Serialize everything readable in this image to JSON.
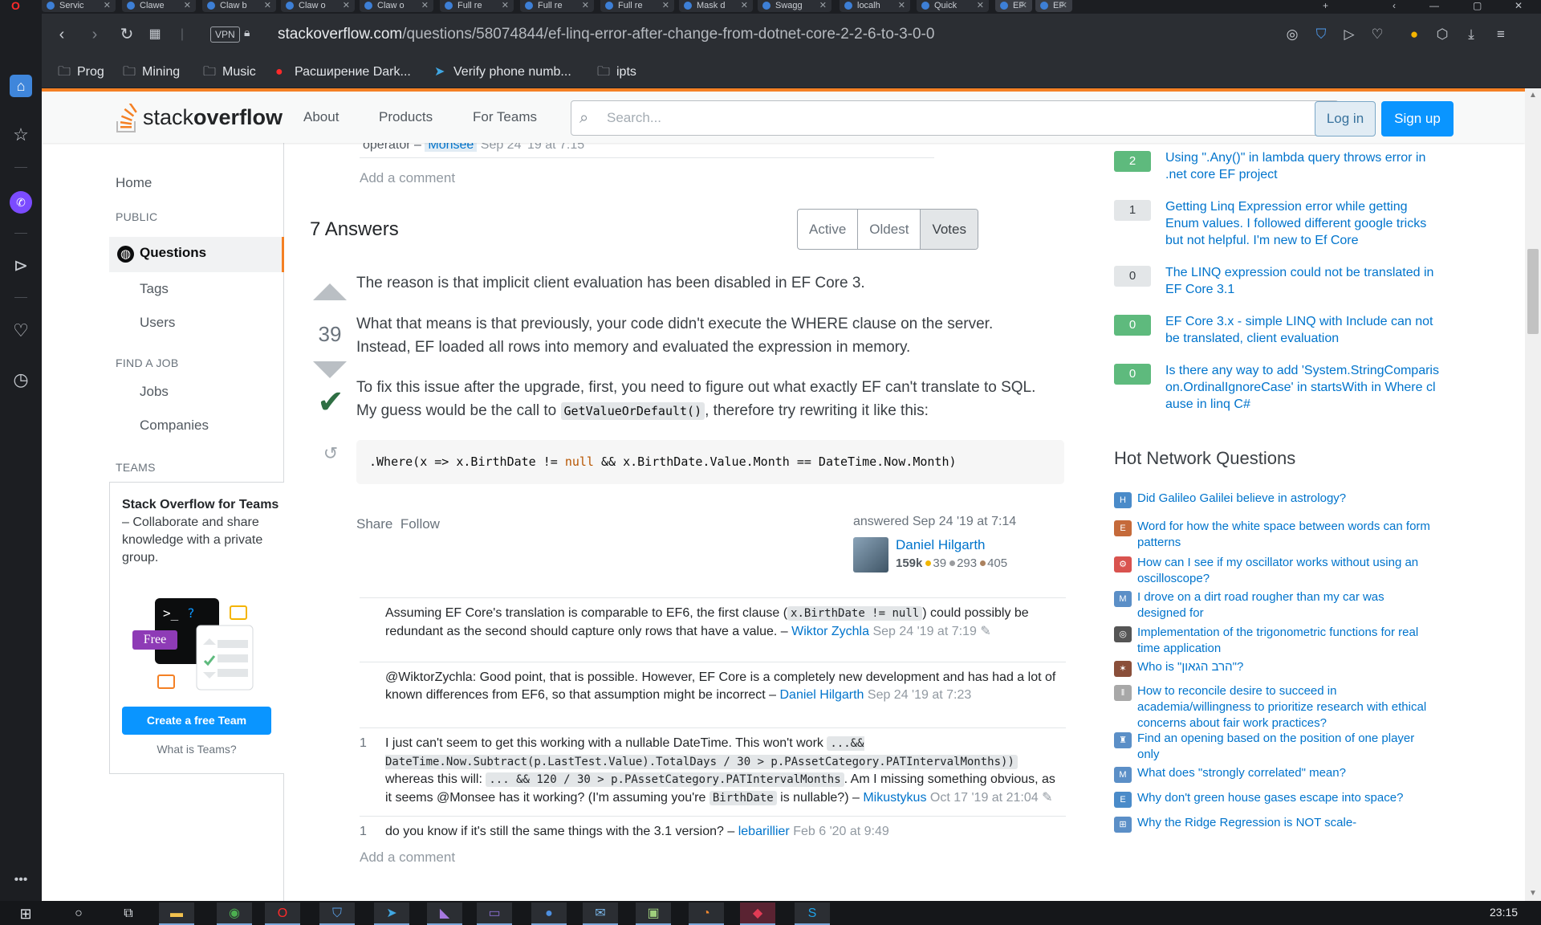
{
  "browser": {
    "tabs": [
      "Servic",
      "Clawe",
      "Claw b",
      "Claw o",
      "Claw o",
      "Full re",
      "Full re",
      "Full re",
      "Mask d",
      "Swagg",
      "localh",
      "Quick",
      "EF",
      "EF"
    ],
    "url_domain": "stackoverflow.com",
    "url_path": "/questions/58074844/ef-linq-error-after-change-from-dotnet-core-2-2-6-to-3-0-0",
    "vpn_label": "VPN",
    "bookmarks": [
      {
        "label": "Prog",
        "icon": "folder-icon"
      },
      {
        "label": "Mining",
        "icon": "folder-icon"
      },
      {
        "label": "Music",
        "icon": "folder-icon"
      },
      {
        "label": "Расширение Dark...",
        "icon": "opera-icon"
      },
      {
        "label": "Verify phone numb...",
        "icon": "telegram-icon"
      },
      {
        "label": "ipts",
        "icon": "folder-icon"
      }
    ]
  },
  "header": {
    "logo_stack": "stack",
    "logo_overflow": "overflow",
    "nav": [
      "About",
      "Products",
      "For Teams"
    ],
    "search_placeholder": "Search...",
    "login": "Log in",
    "signup": "Sign up"
  },
  "leftnav": {
    "home": "Home",
    "public_head": "PUBLIC",
    "questions": "Questions",
    "tags": "Tags",
    "users": "Users",
    "job_head": "FIND A JOB",
    "jobs": "Jobs",
    "companies": "Companies",
    "teams_head": "TEAMS",
    "teams_title": "Stack Overflow for Teams",
    "teams_desc": " – Collaborate and share knowledge with a private group.",
    "free_label": "Free",
    "create_team": "Create a free Team",
    "what_is_teams": "What is Teams?"
  },
  "main": {
    "prev_comment_text": "operator –",
    "prev_comment_user": "Monsee",
    "prev_comment_when": "Sep 24 '19 at 7:15",
    "add_comment": "Add a comment",
    "answers_count": "7 Answers",
    "sort": [
      "Active",
      "Oldest",
      "Votes"
    ],
    "answer": {
      "votes": "39",
      "p1": "The reason is that implicit client evaluation has been disabled in EF Core 3.",
      "p2": "What that means is that previously, your code didn't execute the WHERE clause on the server. Instead, EF loaded all rows into memory and evaluated the expression in memory.",
      "p3a": "To fix this issue after the upgrade, first, you need to figure out what exactly EF can't translate to SQL. My guess would be the call to ",
      "p3_code": "GetValueOrDefault()",
      "p3b": ", therefore try rewriting it like this:",
      "code_a": ".Where(x => x.BirthDate != ",
      "code_kw": "null",
      "code_b": " && x.BirthDate.Value.Month == DateTime.Now.Month)",
      "share": "Share",
      "follow": "Follow",
      "answered": "answered Sep 24 '19 at 7:14",
      "user": "Daniel Hilgarth",
      "rep": "159k",
      "gold": "39",
      "silver": "293",
      "bronze": "405"
    },
    "comments": [
      {
        "score": "",
        "t1": "Assuming EF Core's translation is comparable to EF6, the first clause (",
        "code": "x.BirthDate != null",
        "t2": ") could possibly be redundant as the second should capture only rows that have a value. – ",
        "user": "Wiktor Zychla",
        "when": "Sep 24 '19 at 7:19"
      },
      {
        "score": "",
        "t1": "@WiktorZychla: Good point, that is possible. However, EF Core is a completely new development and has had a lot of known differences from EF6, so that assumption might be incorrect – ",
        "user": "Daniel Hilgarth",
        "when": "Sep 24 '19 at 7:23"
      },
      {
        "score": "1",
        "t1": "I just can't seem to get this working with a nullable DateTime. This won't work ",
        "code1": "...&& DateTime.Now.Subtract(p.LastTest.Value).TotalDays / 30 > p.PAssetCategory.PATIntervalMonths))",
        "t2": " whereas this will: ",
        "code2": "... && 120 / 30 > p.PAssetCategory.PATIntervalMonths",
        "t3": ". Am I missing something obvious, as it seems @Monsee has it working? (I'm assuming you're ",
        "code3": "BirthDate",
        "t4": " is nullable?) – ",
        "user": "Mikustykus",
        "when": "Oct 17 '19 at 21:04"
      },
      {
        "score": "1",
        "t1": "do you know if it's still the same things with the 3.1 version? – ",
        "user": "lebarillier",
        "when": "Feb 6 '20 at 9:49"
      }
    ]
  },
  "related": [
    {
      "count": "2",
      "accepted": true,
      "title": "Using \".Any()\" in lambda query throws error in .net core EF project"
    },
    {
      "count": "1",
      "accepted": false,
      "title": "Getting Linq Expression error while getting Enum values. I followed different google tricks but not helpful. I'm new to Ef Core"
    },
    {
      "count": "0",
      "accepted": false,
      "title": "The LINQ expression could not be translated in EF Core 3.1"
    },
    {
      "count": "0",
      "accepted": true,
      "title": "EF Core 3.x - simple LINQ with Include can not be translated, client evaluation"
    },
    {
      "count": "0",
      "accepted": true,
      "title": "Is there any way to add 'System.StringComparison.OrdinalIgnoreCase' in startsWith in Where clause in linq C#"
    }
  ],
  "hnq_title": "Hot Network Questions",
  "hnq": [
    {
      "title": "Did Galileo Galilei believe in astrology?",
      "color": "#4a8bc9",
      "glyph": "H"
    },
    {
      "title": "Word for how the white space between words can form patterns",
      "color": "#c56a3a",
      "glyph": "E"
    },
    {
      "title": "How can I see if my oscillator works without using an oscilloscope?",
      "color": "#d9534f",
      "glyph": "⚙"
    },
    {
      "title": "I drove on a dirt road rougher than my car was designed for",
      "color": "#5b8fc7",
      "glyph": "M"
    },
    {
      "title": "Implementation of the trigonometric functions for real time application",
      "color": "#555555",
      "glyph": "◎"
    },
    {
      "title": "Who is \"הרב הגאון\"?",
      "color": "#8a4f3a",
      "glyph": "✶"
    },
    {
      "title": "How to reconcile desire to succeed in academia/willingness to prioritize research with ethical concerns about fair work practices?",
      "color": "#a8a8a8",
      "glyph": "‖"
    },
    {
      "title": "Find an opening based on the position of one player only",
      "color": "#5b8fc7",
      "glyph": "♜"
    },
    {
      "title": "What does \"strongly correlated\" mean?",
      "color": "#5b8fc7",
      "glyph": "M"
    },
    {
      "title": "Why don't green house gases escape into space?",
      "color": "#4a8bc9",
      "glyph": "E"
    },
    {
      "title": "Why the Ridge Regression is NOT scale-",
      "color": "#5b8fc7",
      "glyph": "⊞"
    }
  ],
  "taskbar": {
    "clock": "23:15"
  }
}
